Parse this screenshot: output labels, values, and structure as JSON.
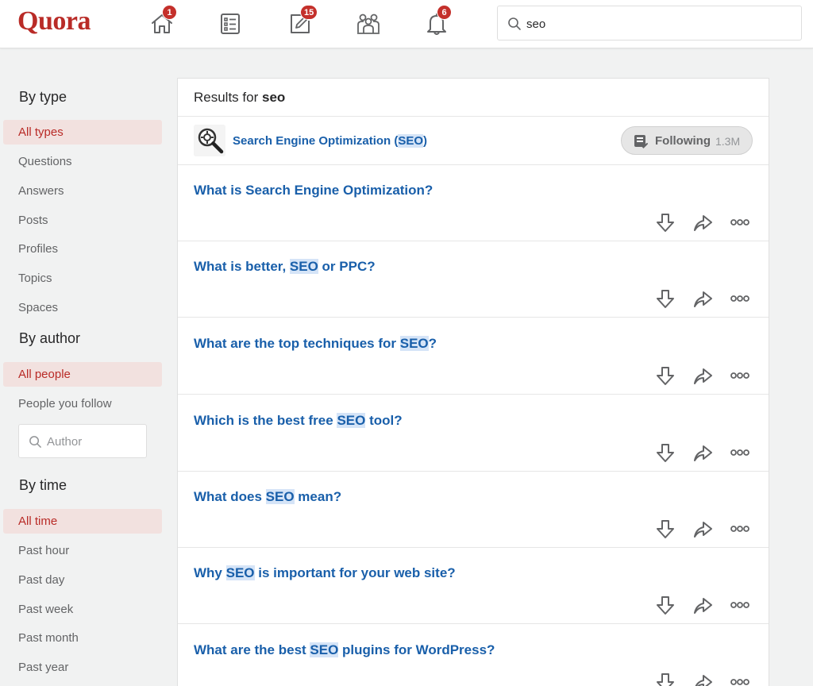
{
  "app": {
    "logo": "Quora"
  },
  "nav": {
    "home_badge": "1",
    "answer_badge": "15",
    "notifications_badge": "6"
  },
  "search": {
    "value": "seo"
  },
  "sidebar": {
    "by_type": {
      "heading": "By type",
      "items": [
        "All types",
        "Questions",
        "Answers",
        "Posts",
        "Profiles",
        "Topics",
        "Spaces"
      ],
      "active": "All types"
    },
    "by_author": {
      "heading": "By author",
      "items": [
        "All people",
        "People you follow"
      ],
      "active": "All people",
      "author_placeholder": "Author"
    },
    "by_time": {
      "heading": "By time",
      "items": [
        "All time",
        "Past hour",
        "Past day",
        "Past week",
        "Past month",
        "Past year"
      ],
      "active": "All time"
    }
  },
  "results": {
    "prefix": "Results for ",
    "query": "seo",
    "topic": {
      "name_before": "Search Engine Optimization (",
      "name_highlight": "SEO",
      "name_after": ")",
      "follow_label": "Following",
      "follow_count": "1.3M"
    },
    "questions": [
      {
        "before": "What is Search Engine Optimization?",
        "hl": "",
        "after": ""
      },
      {
        "before": "What is better, ",
        "hl": "SEO",
        "after": " or PPC?"
      },
      {
        "before": "What are the top techniques for ",
        "hl": "SEO",
        "after": "?"
      },
      {
        "before": "Which is the best free ",
        "hl": "SEO",
        "after": " tool?"
      },
      {
        "before": "What does ",
        "hl": "SEO",
        "after": " mean?"
      },
      {
        "before": "Why ",
        "hl": "SEO",
        "after": " is important for your web site?"
      },
      {
        "before": "What are the best ",
        "hl": "SEO",
        "after": " plugins for WordPress?"
      }
    ]
  },
  "colors": {
    "brand": "#b92b27",
    "link": "#195faa",
    "badge": "#c4302b"
  }
}
